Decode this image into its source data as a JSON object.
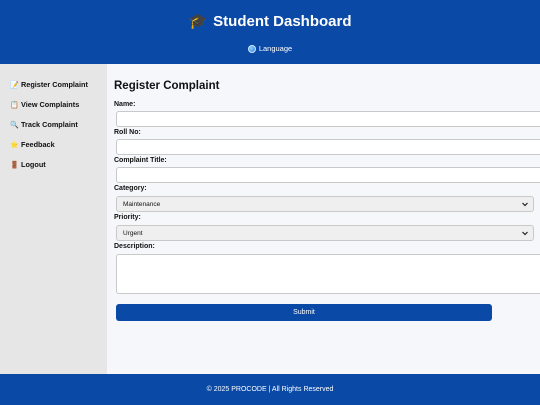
{
  "header": {
    "icon": "graduation-cap-icon",
    "title": "Student Dashboard",
    "language_icon": "globe-icon",
    "language_label": "Language"
  },
  "sidebar": {
    "items": [
      {
        "icon": "memo-icon",
        "glyph": "📝",
        "label": "Register Complaint"
      },
      {
        "icon": "clipboard-icon",
        "glyph": "📋",
        "label": "View Complaints"
      },
      {
        "icon": "magnifier-icon",
        "glyph": "🔍",
        "label": "Track Complaint"
      },
      {
        "icon": "star-icon",
        "glyph": "⭐",
        "label": "Feedback"
      },
      {
        "icon": "door-icon",
        "glyph": "🚪",
        "label": "Logout"
      }
    ]
  },
  "form": {
    "title": "Register Complaint",
    "name_label": "Name:",
    "name_value": "",
    "roll_label": "Roll No:",
    "roll_value": "",
    "complaint_title_label": "Complaint Title:",
    "complaint_title_value": "",
    "category_label": "Category:",
    "category_value": "Maintenance",
    "priority_label": "Priority:",
    "priority_value": "Urgent",
    "description_label": "Description:",
    "description_value": "",
    "submit_label": "Submit"
  },
  "footer": {
    "text": "© 2025 PROCODE | All Rights Reserved"
  },
  "colors": {
    "brand_blue": "#0a4aa6",
    "sidebar_bg": "#e6e6e6",
    "main_bg": "#f5f7fa"
  }
}
